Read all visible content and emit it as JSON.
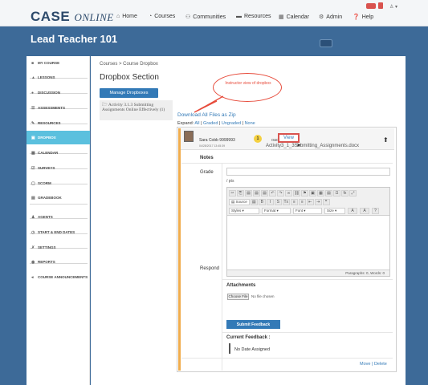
{
  "app": {
    "logo_main": "CASE",
    "logo_sub": "ONLINE"
  },
  "nav": {
    "items": [
      {
        "icon": "home-icon",
        "glyph": "⌂",
        "label": "Home"
      },
      {
        "icon": "courses-icon",
        "glyph": "◔",
        "label": "Courses"
      },
      {
        "icon": "communities-icon",
        "glyph": "⚇",
        "label": "Communities"
      },
      {
        "icon": "resources-icon",
        "glyph": "▬",
        "label": "Resources"
      },
      {
        "icon": "calendar-icon",
        "glyph": "▦",
        "label": "Calendar"
      },
      {
        "icon": "admin-icon",
        "glyph": "⚙",
        "label": "Admin"
      },
      {
        "icon": "help-icon",
        "glyph": "❓",
        "label": "Help"
      }
    ]
  },
  "header": {
    "title": "Lead Teacher 101"
  },
  "sidebar": {
    "items": [
      {
        "icon": "my-course-icon",
        "glyph": "■",
        "label": "MY COURSE"
      },
      {
        "icon": "lessons-icon",
        "glyph": "▲",
        "label": "LESSONS"
      },
      {
        "icon": "discussion-icon",
        "glyph": "●",
        "label": "DISCUSSION"
      },
      {
        "icon": "assessments-icon",
        "glyph": "☰",
        "label": "ASSESSMENTS"
      },
      {
        "icon": "resources-icon",
        "glyph": "✎",
        "label": "RESOURCES"
      },
      {
        "icon": "dropbox-icon",
        "glyph": "▣",
        "label": "DROPBOX"
      },
      {
        "icon": "calendar-icon",
        "glyph": "▦",
        "label": "CALENDAR"
      },
      {
        "icon": "surveys-icon",
        "glyph": "☑",
        "label": "SURVEYS"
      },
      {
        "icon": "scorm-icon",
        "glyph": "▢",
        "label": "SCORM"
      },
      {
        "icon": "gradebook-icon",
        "glyph": "▤",
        "label": "GRADEBOOK"
      },
      {
        "icon": "agents-icon",
        "glyph": "♟",
        "label": "AGENTS"
      },
      {
        "icon": "clock-icon",
        "glyph": "◷",
        "label": "START & END DATES"
      },
      {
        "icon": "settings-icon",
        "glyph": "✗",
        "label": "SETTINGS"
      },
      {
        "icon": "reports-icon",
        "glyph": "◉",
        "label": "REPORTS"
      },
      {
        "icon": "announcements-icon",
        "glyph": "◂",
        "label": "COURSE ANNOUNCEMENTS"
      }
    ],
    "active_index": 5
  },
  "main": {
    "breadcrumb": "Courses > Course Dropbox",
    "section_title": "Dropbox Section",
    "manage_button": "Manage Dropboxes",
    "assignment_label": "Activity 3.1.3 Submitting Assignments Online Effectively (1)",
    "callout_text": "Instructor view of dropbox",
    "download_zip": "Download All Files as Zip",
    "expand_label": "Expand:",
    "expand_links": [
      "All",
      "Graded",
      "Ungraded",
      "None"
    ],
    "expand_seps": [
      " | ",
      " | ",
      " | "
    ],
    "student_name": "Sara Cobb 9999993",
    "student_date": "04/28/2017 13:45:39",
    "step_number": "1",
    "file_label": "oad:",
    "view_button": "View",
    "file_name": "Activity3_1_3Submitting_Assignments.docx",
    "notes_label": "Notes",
    "grade_label": "Grade",
    "pts_label": "/ pts",
    "respond_label": "Respond",
    "editor": {
      "row1": [
        "✂",
        "⎘",
        "▤",
        "▤",
        "▤",
        "↶",
        "↷",
        "∞",
        "⛓",
        "⚑",
        "▣",
        "▦",
        "▤",
        "Ω",
        "fx",
        "⤢"
      ],
      "source_label": "Source",
      "row2": [
        "▤",
        "B",
        "I",
        "S",
        "Tx",
        "≡",
        "≡",
        "⇤",
        "⇥",
        "❞"
      ],
      "styles": "Styles",
      "format": "Format",
      "font": "Font",
      "size": "Size",
      "font_color": "A",
      "bg_color": "A",
      "help": "?",
      "status": "Paragraphs: 0, Words: 0"
    },
    "attachments_label": "Attachments",
    "choose_file": "Choose File",
    "no_file": "No file chosen",
    "submit_button": "Submit Feedback",
    "current_feedback_label": "Current Feedback :",
    "no_date": "No Date Assigned",
    "move_link": "Move",
    "delete_link": "Delete",
    "link_sep": " | "
  }
}
